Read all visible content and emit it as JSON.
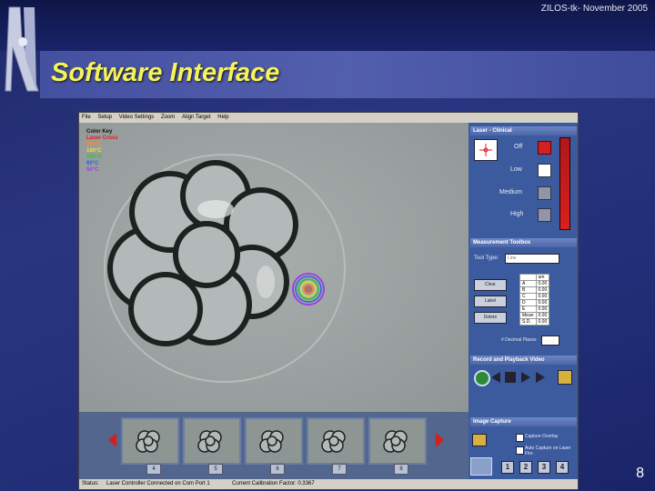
{
  "header": {
    "text": "ZILOS-tk- November 2005"
  },
  "slide": {
    "title": "Software Interface",
    "page_number": "8"
  },
  "app": {
    "menu": [
      "File",
      "Setup",
      "Video Settings",
      "Zoom",
      "Align Target",
      "Help"
    ],
    "color_key": {
      "title": "Color Key",
      "items": [
        {
          "label": "Laser Cross",
          "color": "#e02020"
        },
        {
          "label": "200°C",
          "color": "#ff8a2a"
        },
        {
          "label": "160°C",
          "color": "#e8e030"
        },
        {
          "label": "100°C",
          "color": "#30c040"
        },
        {
          "label": "60°C",
          "color": "#3060e0"
        },
        {
          "label": "50°C",
          "color": "#a040e0"
        }
      ]
    },
    "laser_panel": {
      "title": "Laser - Clinical",
      "levels": [
        "Off",
        "Low",
        "Medium",
        "High"
      ],
      "selected": "Off"
    },
    "measurement": {
      "title": "Measurement Toolbox",
      "tool_type_label": "Tool Type:",
      "tool_type_value": "Line",
      "buttons": [
        "Clear",
        "Label",
        "Delete"
      ],
      "table_header": "um",
      "rows": [
        {
          "k": "A",
          "v": "0.00"
        },
        {
          "k": "B",
          "v": "0.00"
        },
        {
          "k": "C",
          "v": "0.00"
        },
        {
          "k": "D",
          "v": "0.00"
        },
        {
          "k": "E",
          "v": "0.00"
        },
        {
          "k": "Mean",
          "v": "0.00"
        },
        {
          "k": "S.D.",
          "v": "0.00"
        }
      ],
      "decimals_label": "# Decimal Places"
    },
    "video": {
      "title": "Record and Playback Video"
    },
    "capture": {
      "title": "Image Capture",
      "overlay_label": "Capture Overlay",
      "auto_label": "Auto Capture on Laser Fire",
      "number_buttons": [
        "1",
        "2",
        "3",
        "4"
      ]
    },
    "thumbnails": [
      "4",
      "5",
      "6",
      "7",
      "8"
    ],
    "status": {
      "label": "Status:",
      "text": "Laser Controller Connected on Com Port 1",
      "calibration": "Current Calibration Factor: 0.3367"
    }
  }
}
